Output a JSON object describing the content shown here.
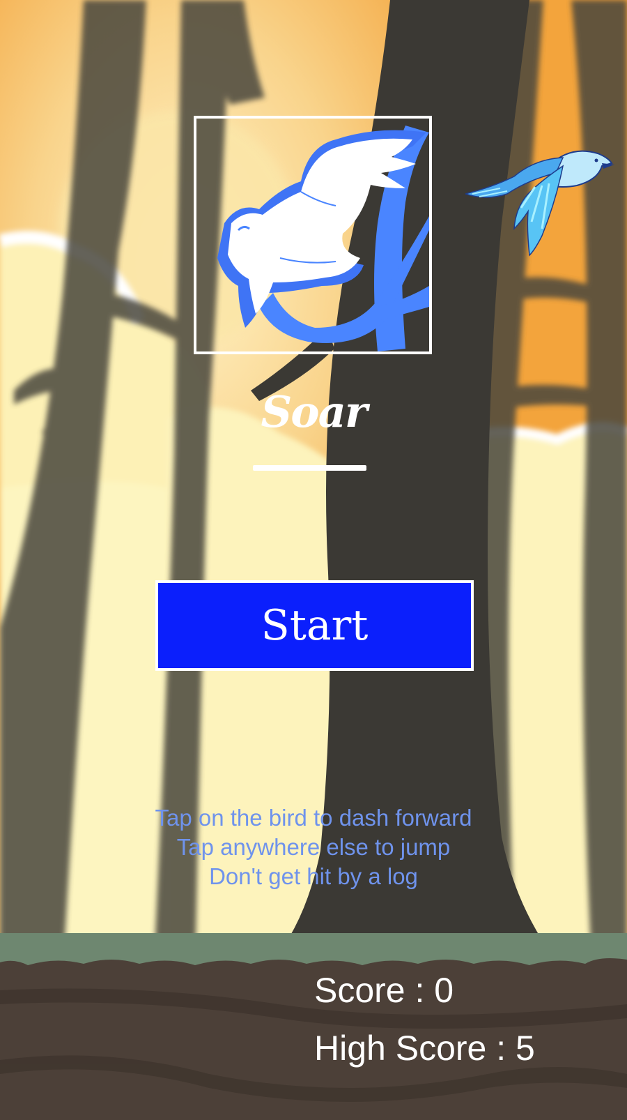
{
  "game": {
    "title": "Soar",
    "start_label": "Start",
    "instructions": [
      "Tap on the bird to dash forward",
      "Tap anywhere else to jump",
      "Don't get hit by a log"
    ],
    "score_label": "Score : 0",
    "high_score_label": "High Score : 5",
    "score": 0,
    "high_score": 5
  },
  "colors": {
    "sky": "#f3a43c",
    "sun_glow": "#fdf5b5",
    "tree_trunk": "#3b3934",
    "grass": "#6e8770",
    "ground": "#4c4038",
    "start_button": "#0b1ffc",
    "instruction_text": "#6f93ec",
    "bird_blue": "#4a85ff"
  },
  "icons": {
    "logo": "white-eagle-icon",
    "player": "blue-bird-icon"
  }
}
